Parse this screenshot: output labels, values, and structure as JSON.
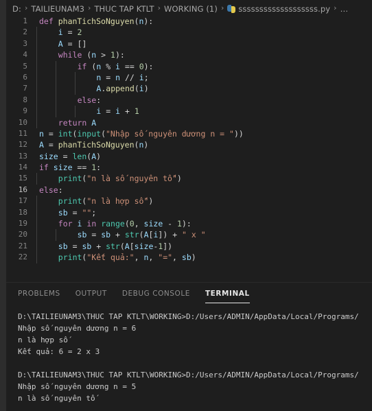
{
  "window": {
    "theme": "vscode-dark",
    "colors": {
      "editor_background": "#1e1e1e",
      "activity_strip": "#2d2d2d",
      "line_number": "#858585",
      "line_number_active": "#c6c6c6",
      "indent_guide": "#404040",
      "keyword": "#c586c0",
      "function": "#dcdcaa",
      "variable": "#9cdcfe",
      "number": "#b5cea8",
      "string": "#ce9178",
      "builtin": "#4ec9b0",
      "foreground": "#d4d4d4",
      "tab_active": "#e7e7e7",
      "tab_inactive": "#8d8d8d"
    }
  },
  "breadcrumb": {
    "separator": "›",
    "items": [
      {
        "label": "D:",
        "icon": null
      },
      {
        "label": "TAILIEUNAM3",
        "icon": null
      },
      {
        "label": "THUC TAP KTLT",
        "icon": null
      },
      {
        "label": "WORKING (1)",
        "icon": null
      },
      {
        "label": "sssssssssssssssssss.py",
        "icon": "python-file-icon"
      },
      {
        "label": "…",
        "icon": null
      }
    ]
  },
  "editor": {
    "language": "python",
    "active_line": 16,
    "lines": [
      {
        "n": 1,
        "indent": 0,
        "guides": 0,
        "tokens": [
          {
            "t": "kw",
            "v": "def"
          },
          {
            "t": "sp",
            "v": " "
          },
          {
            "t": "fn",
            "v": "phanTichSoNguyen"
          },
          {
            "t": "punc",
            "v": "("
          },
          {
            "t": "var",
            "v": "n"
          },
          {
            "t": "punc",
            "v": "):"
          }
        ]
      },
      {
        "n": 2,
        "indent": 1,
        "guides": 1,
        "tokens": [
          {
            "t": "var",
            "v": "i"
          },
          {
            "t": "op",
            "v": " = "
          },
          {
            "t": "num",
            "v": "2"
          }
        ]
      },
      {
        "n": 3,
        "indent": 1,
        "guides": 1,
        "tokens": [
          {
            "t": "var",
            "v": "A"
          },
          {
            "t": "op",
            "v": " = "
          },
          {
            "t": "punc",
            "v": "[]"
          }
        ]
      },
      {
        "n": 4,
        "indent": 1,
        "guides": 1,
        "tokens": [
          {
            "t": "kw",
            "v": "while"
          },
          {
            "t": "sp",
            "v": " "
          },
          {
            "t": "punc",
            "v": "("
          },
          {
            "t": "var",
            "v": "n"
          },
          {
            "t": "op",
            "v": " > "
          },
          {
            "t": "num",
            "v": "1"
          },
          {
            "t": "punc",
            "v": "):"
          }
        ]
      },
      {
        "n": 5,
        "indent": 2,
        "guides": 2,
        "tokens": [
          {
            "t": "kw",
            "v": "if"
          },
          {
            "t": "sp",
            "v": " "
          },
          {
            "t": "punc",
            "v": "("
          },
          {
            "t": "var",
            "v": "n"
          },
          {
            "t": "op",
            "v": " % "
          },
          {
            "t": "var",
            "v": "i"
          },
          {
            "t": "op",
            "v": " == "
          },
          {
            "t": "num",
            "v": "0"
          },
          {
            "t": "punc",
            "v": "):"
          }
        ]
      },
      {
        "n": 6,
        "indent": 3,
        "guides": 3,
        "tokens": [
          {
            "t": "var",
            "v": "n"
          },
          {
            "t": "op",
            "v": " = "
          },
          {
            "t": "var",
            "v": "n"
          },
          {
            "t": "op",
            "v": " // "
          },
          {
            "t": "var",
            "v": "i"
          },
          {
            "t": "punc",
            "v": ";"
          }
        ]
      },
      {
        "n": 7,
        "indent": 3,
        "guides": 3,
        "tokens": [
          {
            "t": "var",
            "v": "A"
          },
          {
            "t": "punc",
            "v": "."
          },
          {
            "t": "fn",
            "v": "append"
          },
          {
            "t": "punc",
            "v": "("
          },
          {
            "t": "var",
            "v": "i"
          },
          {
            "t": "punc",
            "v": ")"
          }
        ]
      },
      {
        "n": 8,
        "indent": 2,
        "guides": 2,
        "tokens": [
          {
            "t": "kw",
            "v": "else"
          },
          {
            "t": "punc",
            "v": ":"
          }
        ]
      },
      {
        "n": 9,
        "indent": 3,
        "guides": 3,
        "tokens": [
          {
            "t": "var",
            "v": "i"
          },
          {
            "t": "op",
            "v": " = "
          },
          {
            "t": "var",
            "v": "i"
          },
          {
            "t": "op",
            "v": " + "
          },
          {
            "t": "num",
            "v": "1"
          }
        ]
      },
      {
        "n": 10,
        "indent": 1,
        "guides": 1,
        "tokens": [
          {
            "t": "kw",
            "v": "return"
          },
          {
            "t": "sp",
            "v": " "
          },
          {
            "t": "var",
            "v": "A"
          }
        ]
      },
      {
        "n": 11,
        "indent": 0,
        "guides": 0,
        "tokens": [
          {
            "t": "var",
            "v": "n"
          },
          {
            "t": "op",
            "v": " = "
          },
          {
            "t": "bi",
            "v": "int"
          },
          {
            "t": "punc",
            "v": "("
          },
          {
            "t": "bi",
            "v": "input"
          },
          {
            "t": "punc",
            "v": "("
          },
          {
            "t": "str",
            "v": "\"Nhập số nguyên dương n = \""
          },
          {
            "t": "punc",
            "v": "))"
          }
        ]
      },
      {
        "n": 12,
        "indent": 0,
        "guides": 0,
        "tokens": [
          {
            "t": "var",
            "v": "A"
          },
          {
            "t": "op",
            "v": " = "
          },
          {
            "t": "fn",
            "v": "phanTichSoNguyen"
          },
          {
            "t": "punc",
            "v": "("
          },
          {
            "t": "var",
            "v": "n"
          },
          {
            "t": "punc",
            "v": ")"
          }
        ]
      },
      {
        "n": 13,
        "indent": 0,
        "guides": 0,
        "tokens": [
          {
            "t": "var",
            "v": "size"
          },
          {
            "t": "op",
            "v": " = "
          },
          {
            "t": "bi",
            "v": "len"
          },
          {
            "t": "punc",
            "v": "("
          },
          {
            "t": "var",
            "v": "A"
          },
          {
            "t": "punc",
            "v": ")"
          }
        ]
      },
      {
        "n": 14,
        "indent": 0,
        "guides": 0,
        "tokens": [
          {
            "t": "kw",
            "v": "if"
          },
          {
            "t": "sp",
            "v": " "
          },
          {
            "t": "var",
            "v": "size"
          },
          {
            "t": "op",
            "v": " == "
          },
          {
            "t": "num",
            "v": "1"
          },
          {
            "t": "punc",
            "v": ":"
          }
        ]
      },
      {
        "n": 15,
        "indent": 1,
        "guides": 1,
        "tokens": [
          {
            "t": "bi",
            "v": "print"
          },
          {
            "t": "punc",
            "v": "("
          },
          {
            "t": "str",
            "v": "\"n là số nguyên tố\""
          },
          {
            "t": "punc",
            "v": ")"
          }
        ]
      },
      {
        "n": 16,
        "indent": 0,
        "guides": 0,
        "tokens": [
          {
            "t": "kw",
            "v": "else"
          },
          {
            "t": "punc",
            "v": ":"
          }
        ]
      },
      {
        "n": 17,
        "indent": 1,
        "guides": 1,
        "tokens": [
          {
            "t": "bi",
            "v": "print"
          },
          {
            "t": "punc",
            "v": "("
          },
          {
            "t": "str",
            "v": "\"n là hợp số\""
          },
          {
            "t": "punc",
            "v": ")"
          }
        ]
      },
      {
        "n": 18,
        "indent": 1,
        "guides": 1,
        "tokens": [
          {
            "t": "var",
            "v": "sb"
          },
          {
            "t": "op",
            "v": " = "
          },
          {
            "t": "str",
            "v": "\"\""
          },
          {
            "t": "punc",
            "v": ";"
          }
        ]
      },
      {
        "n": 19,
        "indent": 1,
        "guides": 1,
        "tokens": [
          {
            "t": "kw",
            "v": "for"
          },
          {
            "t": "sp",
            "v": " "
          },
          {
            "t": "var",
            "v": "i"
          },
          {
            "t": "sp",
            "v": " "
          },
          {
            "t": "kw",
            "v": "in"
          },
          {
            "t": "sp",
            "v": " "
          },
          {
            "t": "bi",
            "v": "range"
          },
          {
            "t": "punc",
            "v": "("
          },
          {
            "t": "num",
            "v": "0"
          },
          {
            "t": "punc",
            "v": ", "
          },
          {
            "t": "var",
            "v": "size"
          },
          {
            "t": "op",
            "v": " - "
          },
          {
            "t": "num",
            "v": "1"
          },
          {
            "t": "punc",
            "v": "):"
          }
        ]
      },
      {
        "n": 20,
        "indent": 2,
        "guides": 2,
        "tokens": [
          {
            "t": "var",
            "v": "sb"
          },
          {
            "t": "op",
            "v": " = "
          },
          {
            "t": "var",
            "v": "sb"
          },
          {
            "t": "op",
            "v": " + "
          },
          {
            "t": "bi",
            "v": "str"
          },
          {
            "t": "punc",
            "v": "("
          },
          {
            "t": "var",
            "v": "A"
          },
          {
            "t": "punc",
            "v": "["
          },
          {
            "t": "var",
            "v": "i"
          },
          {
            "t": "punc",
            "v": "])"
          },
          {
            "t": "op",
            "v": " + "
          },
          {
            "t": "str",
            "v": "\" x \""
          }
        ]
      },
      {
        "n": 21,
        "indent": 1,
        "guides": 1,
        "tokens": [
          {
            "t": "var",
            "v": "sb"
          },
          {
            "t": "op",
            "v": " = "
          },
          {
            "t": "var",
            "v": "sb"
          },
          {
            "t": "op",
            "v": " + "
          },
          {
            "t": "bi",
            "v": "str"
          },
          {
            "t": "punc",
            "v": "("
          },
          {
            "t": "var",
            "v": "A"
          },
          {
            "t": "punc",
            "v": "["
          },
          {
            "t": "var",
            "v": "size"
          },
          {
            "t": "op",
            "v": "-"
          },
          {
            "t": "num",
            "v": "1"
          },
          {
            "t": "punc",
            "v": "])"
          }
        ]
      },
      {
        "n": 22,
        "indent": 1,
        "guides": 1,
        "tokens": [
          {
            "t": "bi",
            "v": "print"
          },
          {
            "t": "punc",
            "v": "("
          },
          {
            "t": "str",
            "v": "\"Kết quả:\""
          },
          {
            "t": "punc",
            "v": ", "
          },
          {
            "t": "var",
            "v": "n"
          },
          {
            "t": "punc",
            "v": ", "
          },
          {
            "t": "str",
            "v": "\"=\""
          },
          {
            "t": "punc",
            "v": ", "
          },
          {
            "t": "var",
            "v": "sb"
          },
          {
            "t": "punc",
            "v": ")"
          }
        ]
      }
    ]
  },
  "panel": {
    "tabs": [
      {
        "label": "PROBLEMS",
        "active": false
      },
      {
        "label": "OUTPUT",
        "active": false
      },
      {
        "label": "DEBUG CONSOLE",
        "active": false
      },
      {
        "label": "TERMINAL",
        "active": true
      }
    ],
    "terminal_lines": [
      "D:\\TAILIEUNAM3\\THUC TAP KTLT\\WORKING>D:/Users/ADMIN/AppData/Local/Programs/",
      "Nhập số nguyên dương n = 6",
      "n là hợp số",
      "Kết quả: 6 = 2 x 3",
      "",
      "D:\\TAILIEUNAM3\\THUC TAP KTLT\\WORKING>D:/Users/ADMIN/AppData/Local/Programs/",
      "Nhập số nguyên dương n = 5",
      "n là số nguyên tố"
    ]
  }
}
